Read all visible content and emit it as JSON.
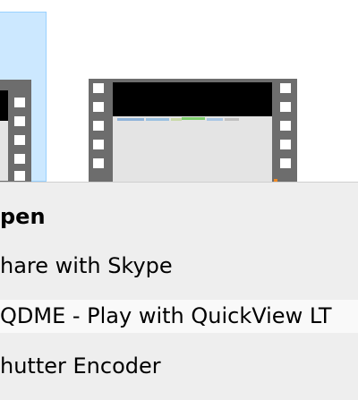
{
  "context_menu": {
    "items": [
      {
        "label": "pen",
        "default": true
      },
      {
        "label": "hare with Skype"
      },
      {
        "label": "QDME - Play with QuickView LT"
      },
      {
        "label": "hutter Encoder"
      }
    ]
  },
  "colors": {
    "selection": "#cce8ff",
    "menu_background": "#eeeeee",
    "filmstrip": "#6d6d6d"
  },
  "icons": [
    "video-file-icon-selected",
    "video-file-icon"
  ]
}
